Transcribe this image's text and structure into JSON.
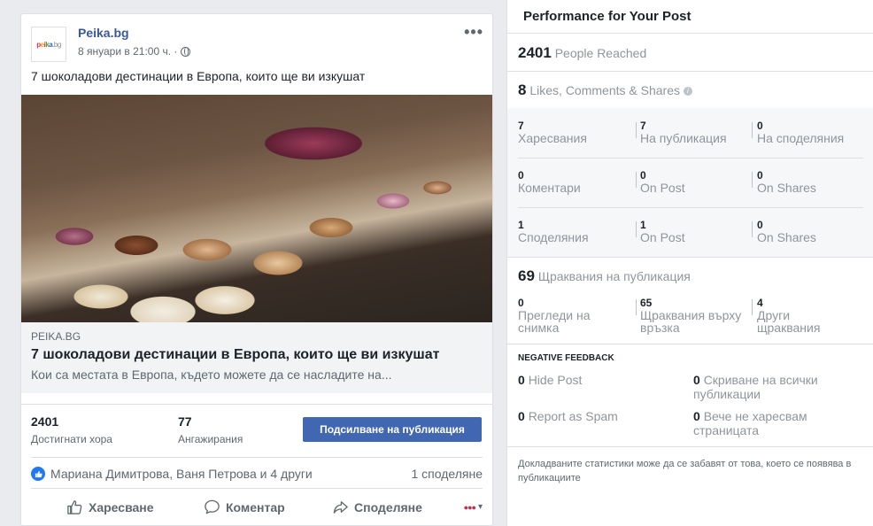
{
  "post": {
    "page_name": "Peika.bg",
    "logo_text": "peika.bg",
    "date": "8 януари в 21:00 ч. ·",
    "more_icon": "•••",
    "text": "7 шоколадови дестинации в Европа, които ще ви изкушат",
    "link": {
      "source": "PEIKA.BG",
      "title": "7 шоколадови дестинации в Европа, които ще ви изкушат",
      "description": "Кои са местата в Европа, където можете да се насладите на..."
    },
    "stats": {
      "reached_value": "2401",
      "reached_label": "Достигнати хора",
      "engagement_value": "77",
      "engagement_label": "Ангажирания",
      "boost_label": "Подсилване на публикация"
    },
    "reactions": {
      "names": "Мариана Димитрова, Ваня Петрова и 4 други",
      "shares": "1 споделяне"
    },
    "actions": {
      "like": "Харесване",
      "comment": "Коментар",
      "share": "Споделяне",
      "audience_icon": "▾"
    }
  },
  "performance": {
    "title": "Performance for Your Post",
    "people_reached": {
      "value": "2401",
      "label": "People Reached"
    },
    "engagement": {
      "value": "8",
      "label": "Likes, Comments & Shares"
    },
    "rows": [
      [
        {
          "n": "7",
          "l": "Харесвания"
        },
        {
          "n": "7",
          "l": "На публикация"
        },
        {
          "n": "0",
          "l": "На споделяния"
        }
      ],
      [
        {
          "n": "0",
          "l": "Коментари"
        },
        {
          "n": "0",
          "l": "On Post"
        },
        {
          "n": "0",
          "l": "On Shares"
        }
      ],
      [
        {
          "n": "1",
          "l": "Споделяния"
        },
        {
          "n": "1",
          "l": "On Post"
        },
        {
          "n": "0",
          "l": "On Shares"
        }
      ]
    ],
    "clicks": {
      "value": "69",
      "label": "Щраквания на публикация"
    },
    "click_rows": [
      {
        "n": "0",
        "l1": "Прегледи на",
        "l2": "снимка"
      },
      {
        "n": "65",
        "l1": "Щраквания върху",
        "l2": "връзка"
      },
      {
        "n": "4",
        "l1": "Други",
        "l2": "щраквания"
      }
    ],
    "negative": {
      "title": "NEGATIVE FEEDBACK",
      "hide_post_value": "0",
      "hide_post_label": "Hide Post",
      "hide_all_value": "0",
      "hide_all_label_1": "Скриване на всички",
      "hide_all_label_2": "публикации",
      "spam_value": "0",
      "spam_label": "Report as Spam",
      "unlike_value": "0",
      "unlike_label_1": "Вече не харесвам",
      "unlike_label_2": "страницата"
    },
    "footnote": "Докладваните статистики може да се забавят от това, което се появява в публикациите"
  }
}
